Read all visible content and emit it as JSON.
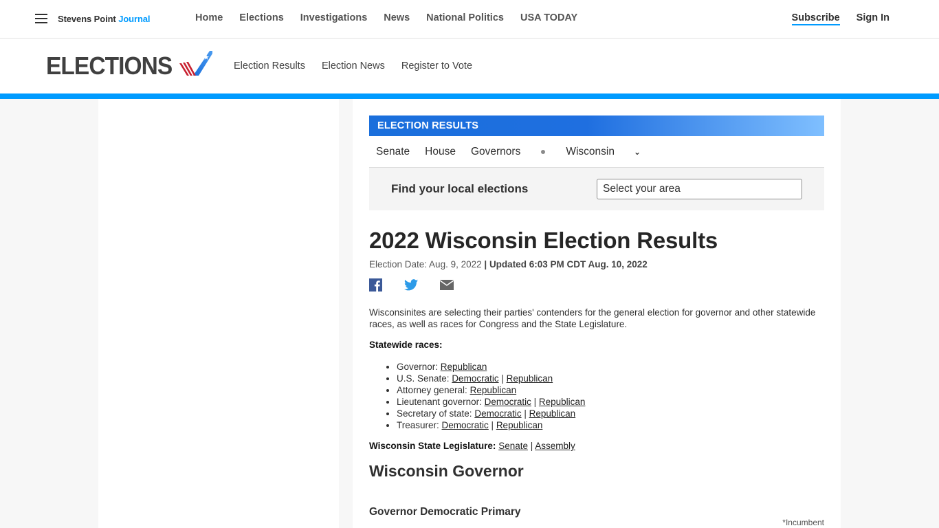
{
  "topbar": {
    "brand_main": "Stevens Point",
    "brand_accent": "Journal",
    "nav": [
      "Home",
      "Elections",
      "Investigations",
      "News",
      "National Politics",
      "USA TODAY"
    ],
    "subscribe": "Subscribe",
    "sign_in": "Sign In",
    "accent_color": "#009bff"
  },
  "elections_header": {
    "logo_text": "ELECTIONS",
    "subnav": [
      "Election Results",
      "Election News",
      "Register to Vote"
    ]
  },
  "results_widget": {
    "banner": "ELECTION RESULTS",
    "race_tabs": [
      "Senate",
      "House",
      "Governors"
    ],
    "state_selected": "Wisconsin",
    "finder_label": "Find your local elections",
    "finder_placeholder": "Select your area"
  },
  "article": {
    "title": "2022 Wisconsin Election Results",
    "election_date": "Election Date: Aug. 9, 2022",
    "separator": "|",
    "updated": "Updated 6:03 PM CDT Aug. 10, 2022",
    "share_icons": [
      "facebook-icon",
      "twitter-icon",
      "email-icon"
    ],
    "intro": "Wisconsinites are selecting their parties' contenders for the general election for governor and other statewide races, as well as races for Congress and the State Legislature.",
    "statewide_heading": "Statewide races:",
    "races": [
      {
        "label": "Governor:",
        "links": [
          "Republican"
        ]
      },
      {
        "label": "U.S. Senate:",
        "links": [
          "Democratic",
          "Republican"
        ]
      },
      {
        "label": "Attorney general:",
        "links": [
          "Republican"
        ]
      },
      {
        "label": "Lieutenant governor:",
        "links": [
          "Democratic",
          "Republican"
        ]
      },
      {
        "label": "Secretary of state:",
        "links": [
          "Democratic",
          "Republican"
        ]
      },
      {
        "label": "Treasurer:",
        "links": [
          "Democratic",
          "Republican"
        ]
      }
    ],
    "legislature_label": "Wisconsin State Legislature:",
    "legislature_links": [
      "Senate",
      "Assembly"
    ],
    "section_heading": "Wisconsin Governor",
    "subsection_heading": "Governor Democratic Primary",
    "incumbent_note": "*Incumbent"
  }
}
